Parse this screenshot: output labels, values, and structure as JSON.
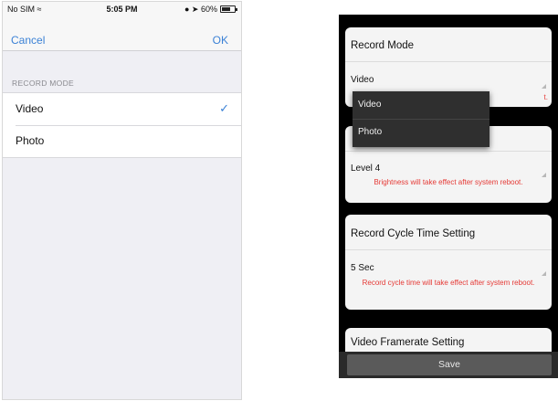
{
  "ios": {
    "statusbar": {
      "carrier": "No SIM",
      "time": "5:05 PM",
      "battery": "60%"
    },
    "navbar": {
      "cancel": "Cancel",
      "ok": "OK"
    },
    "section_header": "RECORD MODE",
    "options": [
      {
        "label": "Video",
        "selected": true
      },
      {
        "label": "Photo",
        "selected": false
      }
    ]
  },
  "android": {
    "record_mode": {
      "title": "Record Mode",
      "value": "Video",
      "warning_fragment": "t."
    },
    "dropdown": {
      "options": [
        "Video",
        "Photo"
      ]
    },
    "brightness": {
      "value": "Level 4",
      "warning": "Brightness will take effect after system reboot."
    },
    "record_cycle": {
      "title": "Record Cycle Time Setting",
      "value": "5 Sec",
      "warning": "Record cycle time will take effect after system reboot."
    },
    "video_framerate": {
      "title": "Video Framerate Setting"
    },
    "save_label": "Save",
    "colors": {
      "warning": "#e53935",
      "ios_accent": "#3c82d6"
    }
  }
}
